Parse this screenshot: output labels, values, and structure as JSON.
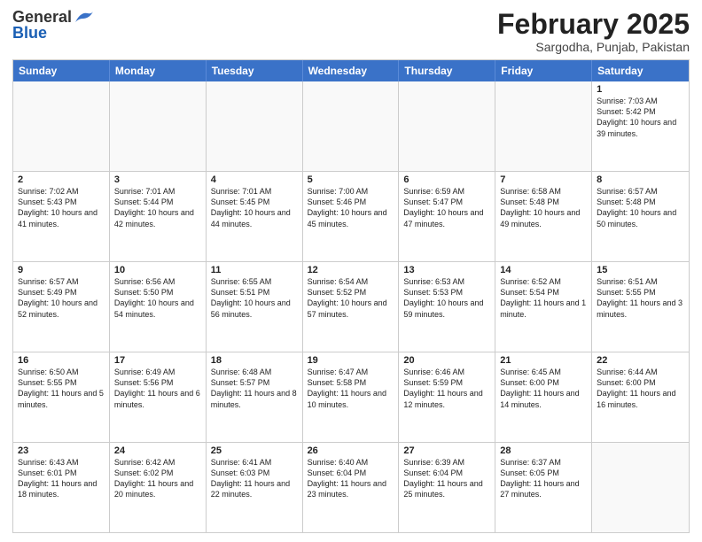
{
  "header": {
    "logo_general": "General",
    "logo_blue": "Blue",
    "month_title": "February 2025",
    "location": "Sargodha, Punjab, Pakistan"
  },
  "days_of_week": [
    "Sunday",
    "Monday",
    "Tuesday",
    "Wednesday",
    "Thursday",
    "Friday",
    "Saturday"
  ],
  "weeks": [
    [
      {
        "day": "",
        "text": ""
      },
      {
        "day": "",
        "text": ""
      },
      {
        "day": "",
        "text": ""
      },
      {
        "day": "",
        "text": ""
      },
      {
        "day": "",
        "text": ""
      },
      {
        "day": "",
        "text": ""
      },
      {
        "day": "1",
        "text": "Sunrise: 7:03 AM\nSunset: 5:42 PM\nDaylight: 10 hours and 39 minutes."
      }
    ],
    [
      {
        "day": "2",
        "text": "Sunrise: 7:02 AM\nSunset: 5:43 PM\nDaylight: 10 hours and 41 minutes."
      },
      {
        "day": "3",
        "text": "Sunrise: 7:01 AM\nSunset: 5:44 PM\nDaylight: 10 hours and 42 minutes."
      },
      {
        "day": "4",
        "text": "Sunrise: 7:01 AM\nSunset: 5:45 PM\nDaylight: 10 hours and 44 minutes."
      },
      {
        "day": "5",
        "text": "Sunrise: 7:00 AM\nSunset: 5:46 PM\nDaylight: 10 hours and 45 minutes."
      },
      {
        "day": "6",
        "text": "Sunrise: 6:59 AM\nSunset: 5:47 PM\nDaylight: 10 hours and 47 minutes."
      },
      {
        "day": "7",
        "text": "Sunrise: 6:58 AM\nSunset: 5:48 PM\nDaylight: 10 hours and 49 minutes."
      },
      {
        "day": "8",
        "text": "Sunrise: 6:57 AM\nSunset: 5:48 PM\nDaylight: 10 hours and 50 minutes."
      }
    ],
    [
      {
        "day": "9",
        "text": "Sunrise: 6:57 AM\nSunset: 5:49 PM\nDaylight: 10 hours and 52 minutes."
      },
      {
        "day": "10",
        "text": "Sunrise: 6:56 AM\nSunset: 5:50 PM\nDaylight: 10 hours and 54 minutes."
      },
      {
        "day": "11",
        "text": "Sunrise: 6:55 AM\nSunset: 5:51 PM\nDaylight: 10 hours and 56 minutes."
      },
      {
        "day": "12",
        "text": "Sunrise: 6:54 AM\nSunset: 5:52 PM\nDaylight: 10 hours and 57 minutes."
      },
      {
        "day": "13",
        "text": "Sunrise: 6:53 AM\nSunset: 5:53 PM\nDaylight: 10 hours and 59 minutes."
      },
      {
        "day": "14",
        "text": "Sunrise: 6:52 AM\nSunset: 5:54 PM\nDaylight: 11 hours and 1 minute."
      },
      {
        "day": "15",
        "text": "Sunrise: 6:51 AM\nSunset: 5:55 PM\nDaylight: 11 hours and 3 minutes."
      }
    ],
    [
      {
        "day": "16",
        "text": "Sunrise: 6:50 AM\nSunset: 5:55 PM\nDaylight: 11 hours and 5 minutes."
      },
      {
        "day": "17",
        "text": "Sunrise: 6:49 AM\nSunset: 5:56 PM\nDaylight: 11 hours and 6 minutes."
      },
      {
        "day": "18",
        "text": "Sunrise: 6:48 AM\nSunset: 5:57 PM\nDaylight: 11 hours and 8 minutes."
      },
      {
        "day": "19",
        "text": "Sunrise: 6:47 AM\nSunset: 5:58 PM\nDaylight: 11 hours and 10 minutes."
      },
      {
        "day": "20",
        "text": "Sunrise: 6:46 AM\nSunset: 5:59 PM\nDaylight: 11 hours and 12 minutes."
      },
      {
        "day": "21",
        "text": "Sunrise: 6:45 AM\nSunset: 6:00 PM\nDaylight: 11 hours and 14 minutes."
      },
      {
        "day": "22",
        "text": "Sunrise: 6:44 AM\nSunset: 6:00 PM\nDaylight: 11 hours and 16 minutes."
      }
    ],
    [
      {
        "day": "23",
        "text": "Sunrise: 6:43 AM\nSunset: 6:01 PM\nDaylight: 11 hours and 18 minutes."
      },
      {
        "day": "24",
        "text": "Sunrise: 6:42 AM\nSunset: 6:02 PM\nDaylight: 11 hours and 20 minutes."
      },
      {
        "day": "25",
        "text": "Sunrise: 6:41 AM\nSunset: 6:03 PM\nDaylight: 11 hours and 22 minutes."
      },
      {
        "day": "26",
        "text": "Sunrise: 6:40 AM\nSunset: 6:04 PM\nDaylight: 11 hours and 23 minutes."
      },
      {
        "day": "27",
        "text": "Sunrise: 6:39 AM\nSunset: 6:04 PM\nDaylight: 11 hours and 25 minutes."
      },
      {
        "day": "28",
        "text": "Sunrise: 6:37 AM\nSunset: 6:05 PM\nDaylight: 11 hours and 27 minutes."
      },
      {
        "day": "",
        "text": ""
      }
    ]
  ]
}
